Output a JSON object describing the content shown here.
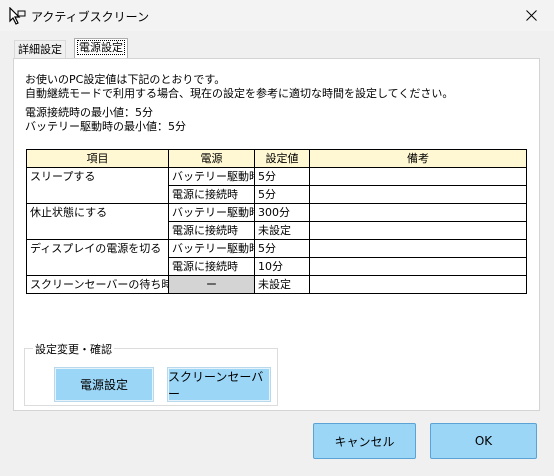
{
  "window": {
    "title": "アクティブスクリーン"
  },
  "tabs": [
    {
      "label": "詳細設定",
      "active": false
    },
    {
      "label": "電源設定",
      "active": true
    }
  ],
  "description": {
    "line1": "お使いのPC設定値は下記のとおりです。",
    "line2": "自動継続モードで利用する場合、現在の設定を参考に適切な時間を設定してください。",
    "line3": "電源接続時の最小値：5分",
    "line4": "バッテリー駆動時の最小値：5分"
  },
  "table": {
    "headers": [
      "項目",
      "電源",
      "設定値",
      "備考"
    ],
    "rows": [
      {
        "item": "スリープする",
        "power": "バッテリー駆動時",
        "value": "5分",
        "note": ""
      },
      {
        "item": "",
        "power": "電源に接続時",
        "value": "5分",
        "note": ""
      },
      {
        "item": "休止状態にする",
        "power": "バッテリー駆動時",
        "value": "300分",
        "note": ""
      },
      {
        "item": "",
        "power": "電源に接続時",
        "value": "未設定",
        "note": ""
      },
      {
        "item": "ディスプレイの電源を切る",
        "power": "バッテリー駆動時",
        "value": "5分",
        "note": ""
      },
      {
        "item": "",
        "power": "電源に接続時",
        "value": "10分",
        "note": ""
      },
      {
        "item": "スクリーンセーバーの待ち時間",
        "power": "ー",
        "value": "未設定",
        "note": ""
      }
    ]
  },
  "settings_group": {
    "legend": "設定変更・確認",
    "power_button": "電源設定",
    "screensaver_button": "スクリーンセーバー"
  },
  "footer": {
    "cancel": "キャンセル",
    "ok": "OK"
  },
  "colors": {
    "header_bg": "#fff8d2",
    "button_blue": "#9bd6f7",
    "dash_cell": "#d4d4d4"
  }
}
